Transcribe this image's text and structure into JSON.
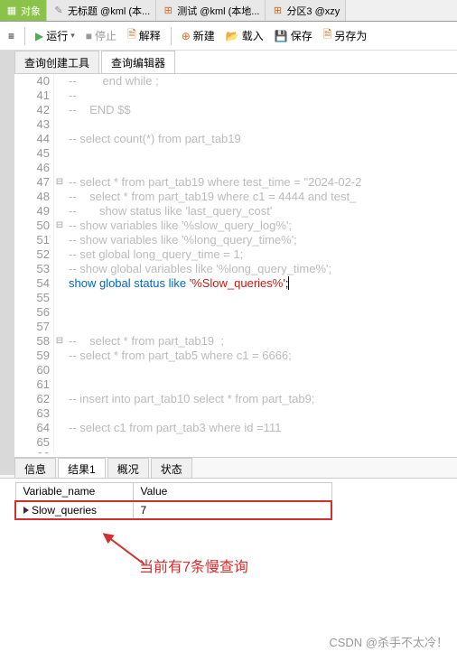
{
  "topTabs": {
    "active": "对象",
    "t1": "无标题 @kml (本...",
    "t2": "测试 @kml (本地...",
    "t3": "分区3 @xzy"
  },
  "toolbar": {
    "menu": "≡",
    "run": "运行",
    "stop": "停止",
    "explain": "解释",
    "new": "新建",
    "load": "载入",
    "save": "保存",
    "saveas": "另存为"
  },
  "subTabs": {
    "builder": "查询创建工具",
    "editor": "查询编辑器"
  },
  "code": {
    "l40": "--        end while ;",
    "l41": "--",
    "l42": "--    END $$",
    "l43": "",
    "l44": "-- select count(*) from part_tab19",
    "l45": "",
    "l46": "",
    "l47": "-- select * from part_tab19 where test_time = \"2024-02-2",
    "l48": "--    select * from part_tab19 where c1 = 4444 and test_",
    "l49": "--       show status like 'last_query_cost'",
    "l50": "-- show variables like '%slow_query_log%';",
    "l51": "-- show variables like '%long_query_time%';",
    "l52": "-- set global long_query_time = 1;",
    "l53": "-- show global variables like '%long_query_time%';",
    "l54_kw": "show global status like ",
    "l54_str": "'%Slow_queries%'",
    "l54_end": ";",
    "l55": "",
    "l56": "",
    "l57": "",
    "l58": "--    select * from part_tab19  ;",
    "l59": "-- select * from part_tab5 where c1 = 6666;",
    "l60": "",
    "l61": "",
    "l62": "-- insert into part_tab10 select * from part_tab9;",
    "l63": "",
    "l64": "-- select c1 from part_tab3 where id =111",
    "l65": "",
    "l66": ""
  },
  "resultTabs": {
    "info": "信息",
    "result1": "结果1",
    "profile": "概况",
    "status": "状态"
  },
  "resultGrid": {
    "h1": "Variable_name",
    "h2": "Value",
    "r1c1": "Slow_queries",
    "r1c2": "7"
  },
  "annotation": "当前有7条慢查询",
  "watermark": "CSDN @杀手不太冷！"
}
